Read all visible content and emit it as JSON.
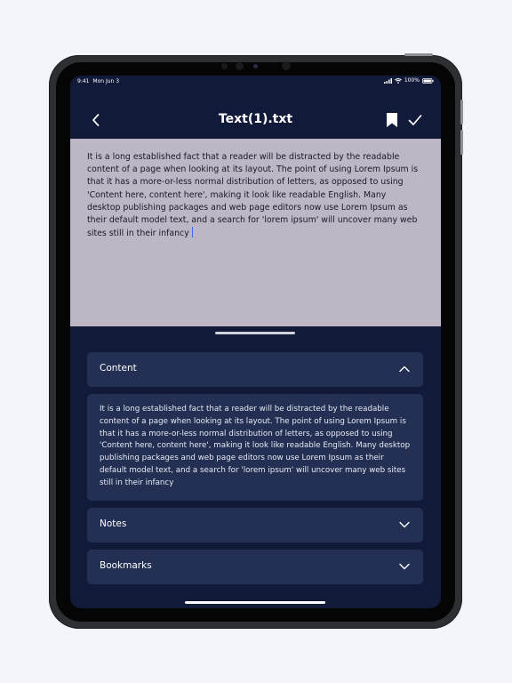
{
  "status_bar": {
    "time": "9:41",
    "date": "Mon Jun 3",
    "battery": "100%"
  },
  "nav": {
    "title": "Text(1).txt",
    "back_icon": "chevron-left-icon",
    "bookmark_icon": "bookmark-icon",
    "confirm_icon": "checkmark-icon"
  },
  "editor": {
    "text": "It is a long established fact that a reader will be distracted by the readable content of a page when looking at its layout. The point of using Lorem Ipsum is that it has a more-or-less normal distribution of letters, as opposed to using 'Content here, content here', making it look like readable English. Many desktop publishing packages and web page editors now use Lorem Ipsum as their default model text, and a search for 'lorem ipsum' will uncover many web sites still in their infancy"
  },
  "sections": {
    "content": {
      "label": "Content",
      "expanded": true,
      "body": "It is a long established fact that a reader will be distracted by the readable content of a page when looking at its layout. The point of using Lorem Ipsum is that it has a more-or-less normal distribution of letters, as opposed to using 'Content here, content here', making it look like readable English. Many desktop publishing packages and web page editors now use Lorem Ipsum as their default model text, and a search for 'lorem ipsum' will uncover many web sites still in their infancy"
    },
    "notes": {
      "label": "Notes",
      "expanded": false
    },
    "bookmarks": {
      "label": "Bookmarks",
      "expanded": false
    }
  },
  "colors": {
    "background": "#121a3a",
    "editor_bg": "#bdb6c4",
    "card_bg": "#233054",
    "cursor": "#3b6cf0"
  }
}
